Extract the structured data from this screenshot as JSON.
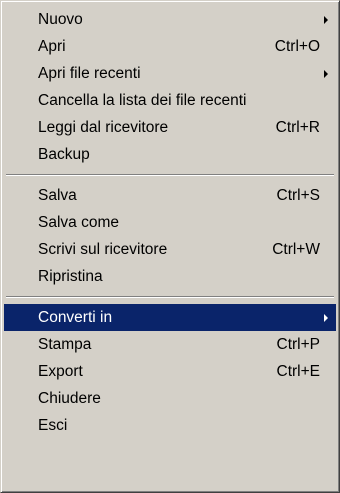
{
  "menu": {
    "items": [
      {
        "label": "Nuovo",
        "shortcut": "",
        "submenu": true
      },
      {
        "label": "Apri",
        "shortcut": "Ctrl+O",
        "submenu": false
      },
      {
        "label": "Apri file recenti",
        "shortcut": "",
        "submenu": true
      },
      {
        "label": "Cancella la lista dei file recenti",
        "shortcut": "",
        "submenu": false
      },
      {
        "label": "Leggi dal ricevitore",
        "shortcut": "Ctrl+R",
        "submenu": false
      },
      {
        "label": "Backup",
        "shortcut": "",
        "submenu": false
      },
      {
        "label": "Salva",
        "shortcut": "Ctrl+S",
        "submenu": false
      },
      {
        "label": "Salva come",
        "shortcut": "",
        "submenu": false
      },
      {
        "label": "Scrivi sul ricevitore",
        "shortcut": "Ctrl+W",
        "submenu": false
      },
      {
        "label": "Ripristina",
        "shortcut": "",
        "submenu": false
      },
      {
        "label": "Converti in",
        "shortcut": "",
        "submenu": true,
        "selected": true
      },
      {
        "label": "Stampa",
        "shortcut": "Ctrl+P",
        "submenu": false
      },
      {
        "label": "Export",
        "shortcut": "Ctrl+E",
        "submenu": false
      },
      {
        "label": "Chiudere",
        "shortcut": "",
        "submenu": false
      },
      {
        "label": "Esci",
        "shortcut": "",
        "submenu": false
      }
    ]
  },
  "colors": {
    "menu_background": "#d4d0c8",
    "highlight_background": "#0a246a",
    "highlight_text": "#ffffff"
  },
  "icons": {
    "submenu_arrow": "chevron-right-icon"
  }
}
